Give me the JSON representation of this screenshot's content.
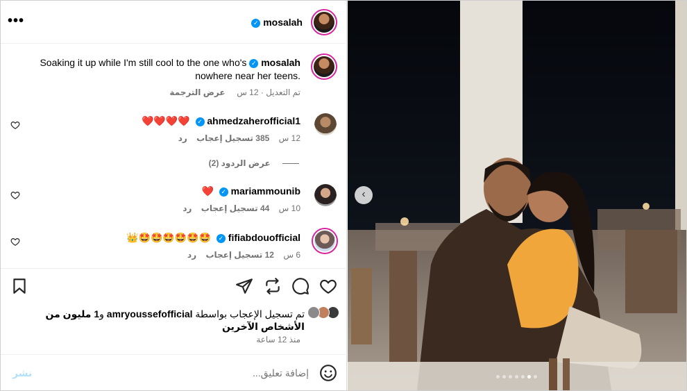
{
  "post": {
    "author": "mosalah",
    "more_icon": "more-horizontal-icon",
    "caption": {
      "author": "mosalah",
      "text_before": "Soaking it up while I'm still cool to the one who's",
      "text_after": "nowhere near her teens.",
      "edited_label": "تم التعديل",
      "time": "12 س",
      "translate_label": "عرض الترجمة"
    }
  },
  "comments": [
    {
      "username": "ahmedzaherofficial1",
      "emoji": "❤️❤️❤️❤️",
      "time": "12 س",
      "likes": "385 تسجيل إعجاب",
      "reply_label": "رد",
      "view_replies": "عرض الردود (2)"
    },
    {
      "username": "mariammounib",
      "emoji": "❤️",
      "time": "10 س",
      "likes": "44 تسجيل إعجاب",
      "reply_label": "رد"
    },
    {
      "username": "fifiabdouofficial",
      "emoji": "👑🤩🤩🤩🤩🤩🤩",
      "time": "6 س",
      "likes": "12 تسجيل إعجاب",
      "reply_label": "رد"
    }
  ],
  "actions": {
    "icons": [
      "bookmark-icon",
      "send-icon",
      "repost-icon",
      "comment-icon",
      "heart-icon"
    ]
  },
  "likes_summary": {
    "prefix": "تم تسجيل الإعجاب بواسطة",
    "user": "amryoussefofficial",
    "and": "و",
    "others": "1 مليون من الأشخاص الآخرين"
  },
  "time_ago": "منذ 12 ساعة",
  "comment_box": {
    "placeholder": "إضافة تعليق...",
    "post_label": "نشر"
  },
  "carousel": {
    "count": 7,
    "active_index": 5
  },
  "colors": {
    "verified": "#0095f6",
    "heart": "#e0245e",
    "story_ring": "#d6249f",
    "post_button": "#b2dffc"
  }
}
